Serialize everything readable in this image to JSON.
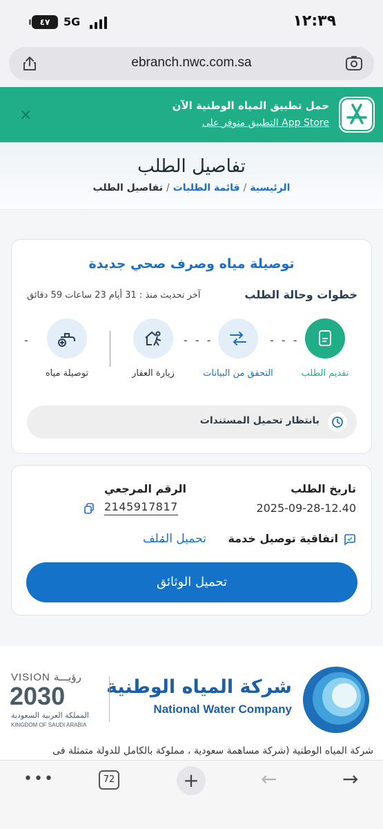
{
  "status_bar": {
    "time": "١٢:٣٩",
    "battery": "٤٧",
    "network": "5G"
  },
  "browser": {
    "url": "ebranch.nwc.com.sa",
    "tab_count": "72"
  },
  "app_banner": {
    "title": "حمل تطبيق المياه الوطنية الآن",
    "subtitle": "التطبيق متوفر على App Store"
  },
  "header": {
    "title": "تفاصيل الطلب",
    "breadcrumb": {
      "home": "الرئيسية",
      "list": "قائمة الطلبات",
      "current": "تفاصيل الطلب",
      "separator": "/"
    }
  },
  "request": {
    "service_title": "توصيلة مياه وصرف صحي جديدة",
    "steps_heading": "خطوات وحالة الطلب",
    "last_update": "آخر تحديث منذ : 31 أيام 23 ساعات 59 دقائق",
    "steps": [
      {
        "label": "تقديم الطلب",
        "icon": "document-icon",
        "state": "active"
      },
      {
        "label": "التحقق من البيانات",
        "icon": "data-flow-icon",
        "state": "pending"
      },
      {
        "label": "زيارة العقار",
        "icon": "property-visit-icon",
        "state": "pending"
      },
      {
        "label": "توصيلة مياه",
        "icon": "water-tap-icon",
        "state": "pending"
      }
    ],
    "status": "بانتظار تحميل المستندات"
  },
  "details": {
    "date_label": "تاريخ الطلب",
    "date_value": "2025-09-28-12.40",
    "ref_label": "الرقم المرجعي",
    "ref_value": "2145917817",
    "agreement_label": "اتفاقية توصيل خدمة",
    "agreement_colon": ":",
    "agreement_link": "تحميل الملف",
    "upload_button": "تحميل الوثائق"
  },
  "footer": {
    "company_ar": "شركة المياه الوطنية",
    "company_en": "National Water Company",
    "vision_text": "VISION رؤيـــة",
    "vision_year": "2030",
    "kingdom_ar": "المملكة العربية السعودية",
    "kingdom_en": "KINGDOM OF SAUDI ARABIA",
    "about": "شركة المياه الوطنية (شركة مساهمة سعودية ، مملوكة بالكامل للدولة متمثلة فى"
  },
  "colors": {
    "brand_green": "#1fae87",
    "brand_blue": "#1472c9",
    "text_blue": "#1a6fc7"
  }
}
